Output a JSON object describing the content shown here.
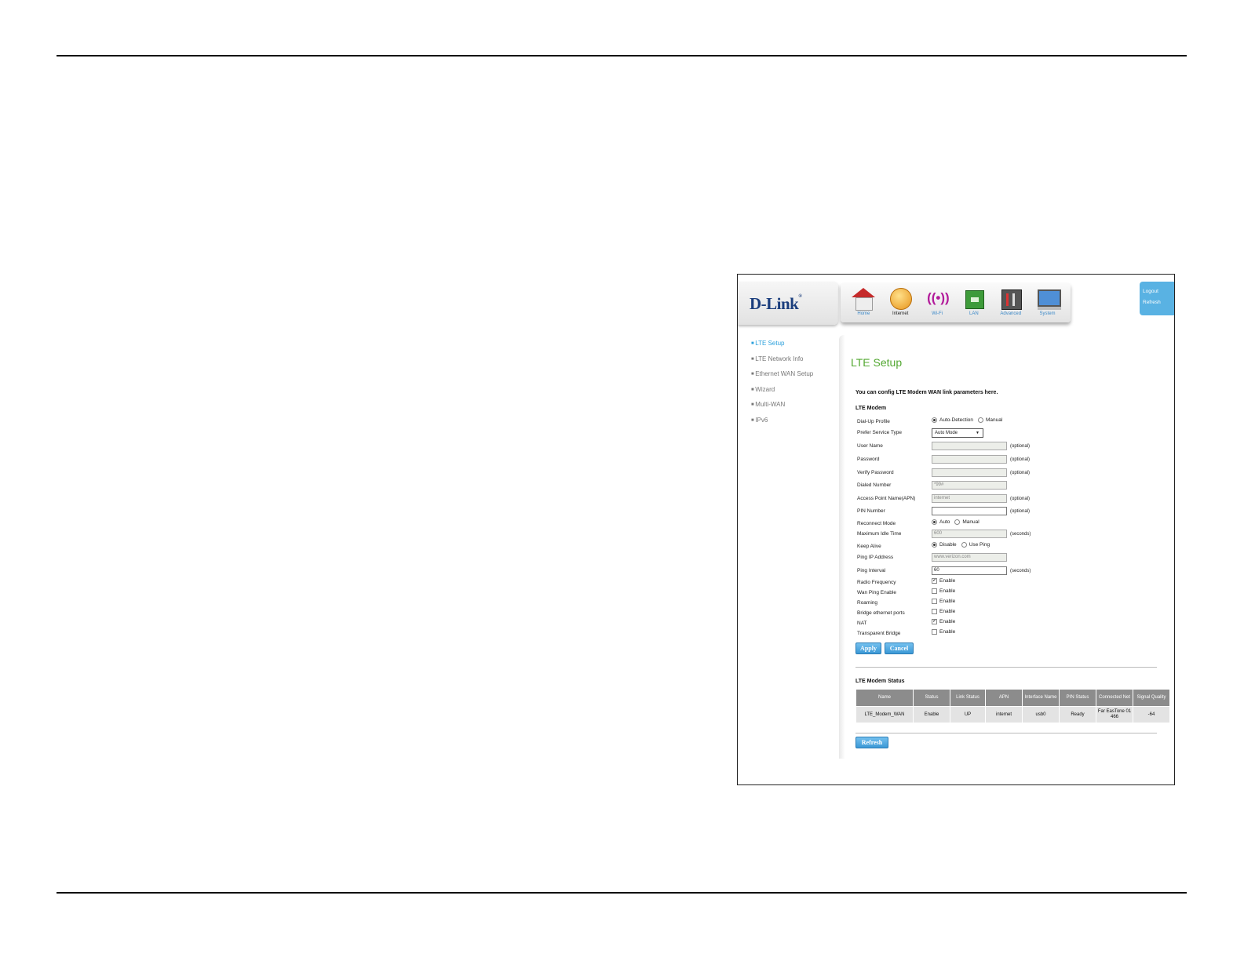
{
  "brand": {
    "logo": "D-Link",
    "accent": "#2aa0dc",
    "title_color": "#53a832"
  },
  "nav": [
    {
      "label": "Home",
      "icon": "house-icon"
    },
    {
      "label": "Internet",
      "icon": "globe-icon"
    },
    {
      "label": "Wi-Fi",
      "icon": "wifi-icon"
    },
    {
      "label": "LAN",
      "icon": "lan-icon"
    },
    {
      "label": "Advanced",
      "icon": "tools-icon"
    },
    {
      "label": "System",
      "icon": "monitor-icon"
    }
  ],
  "topright": {
    "logout": "Logout",
    "refresh": "Refresh"
  },
  "sidebar": [
    {
      "label": "LTE Setup"
    },
    {
      "label": "LTE Network Info"
    },
    {
      "label": "Ethernet WAN Setup"
    },
    {
      "label": "Wizard"
    },
    {
      "label": "Multi-WAN"
    },
    {
      "label": "IPv6"
    }
  ],
  "page": {
    "title": "LTE Setup",
    "intro": "You can config LTE Modem WAN link parameters here.",
    "section": "LTE Modem",
    "status_section": "LTE Modem Status"
  },
  "form": {
    "dialup": {
      "label": "Dial-Up Profile",
      "opt1": "Auto-Detection",
      "opt2": "Manual"
    },
    "service": {
      "label": "Prefer Service Type",
      "value": "Auto Mode"
    },
    "username": {
      "label": "User Name",
      "value": "",
      "hint": "(optional)"
    },
    "password": {
      "label": "Password",
      "value": "",
      "hint": "(optional)"
    },
    "verify": {
      "label": "Verify Password",
      "value": "",
      "hint": "(optional)"
    },
    "dialed": {
      "label": "Dialed Number",
      "value": "*99#"
    },
    "apn": {
      "label": "Access Point Name(APN)",
      "value": "internet",
      "hint": "(optional)"
    },
    "pin": {
      "label": "PIN Number",
      "value": "",
      "hint": "(optional)"
    },
    "reconnect": {
      "label": "Reconnect Mode",
      "opt1": "Auto",
      "opt2": "Manual"
    },
    "idle": {
      "label": "Maximum Idle Time",
      "value": "600",
      "hint": "(seconds)"
    },
    "keepalive": {
      "label": "Keep Alive",
      "opt1": "Disable",
      "opt2": "Use Ping"
    },
    "pingip": {
      "label": "Ping IP Address",
      "value": "www.verizon.com"
    },
    "pinginterval": {
      "label": "Ping Interval",
      "value": "60",
      "hint": "(seconds)"
    },
    "radio": {
      "label": "Radio Frequency",
      "opt": "Enable"
    },
    "wanping": {
      "label": "Wan Ping Enable",
      "opt": "Enable"
    },
    "roaming": {
      "label": "Roaming",
      "opt": "Enable"
    },
    "bridgeports": {
      "label": "Bridge ethernet ports",
      "opt": "Enable"
    },
    "nat": {
      "label": "NAT",
      "opt": "Enable"
    },
    "transparent": {
      "label": "Transparent Bridge",
      "opt": "Enable"
    },
    "apply": "Apply",
    "cancel": "Cancel"
  },
  "status_table": {
    "headers": [
      "Name",
      "Status",
      "Link Status",
      "APN",
      "Interface Name",
      "PIN Status",
      "Connected Net",
      "Signal Quality"
    ],
    "rows": [
      [
        "LTE_Modem_WAN",
        "Enable",
        "UP",
        "internet",
        "usb0",
        "Ready",
        "Far EasTone 01 466",
        "-64"
      ]
    ]
  },
  "refresh_button": "Refresh"
}
